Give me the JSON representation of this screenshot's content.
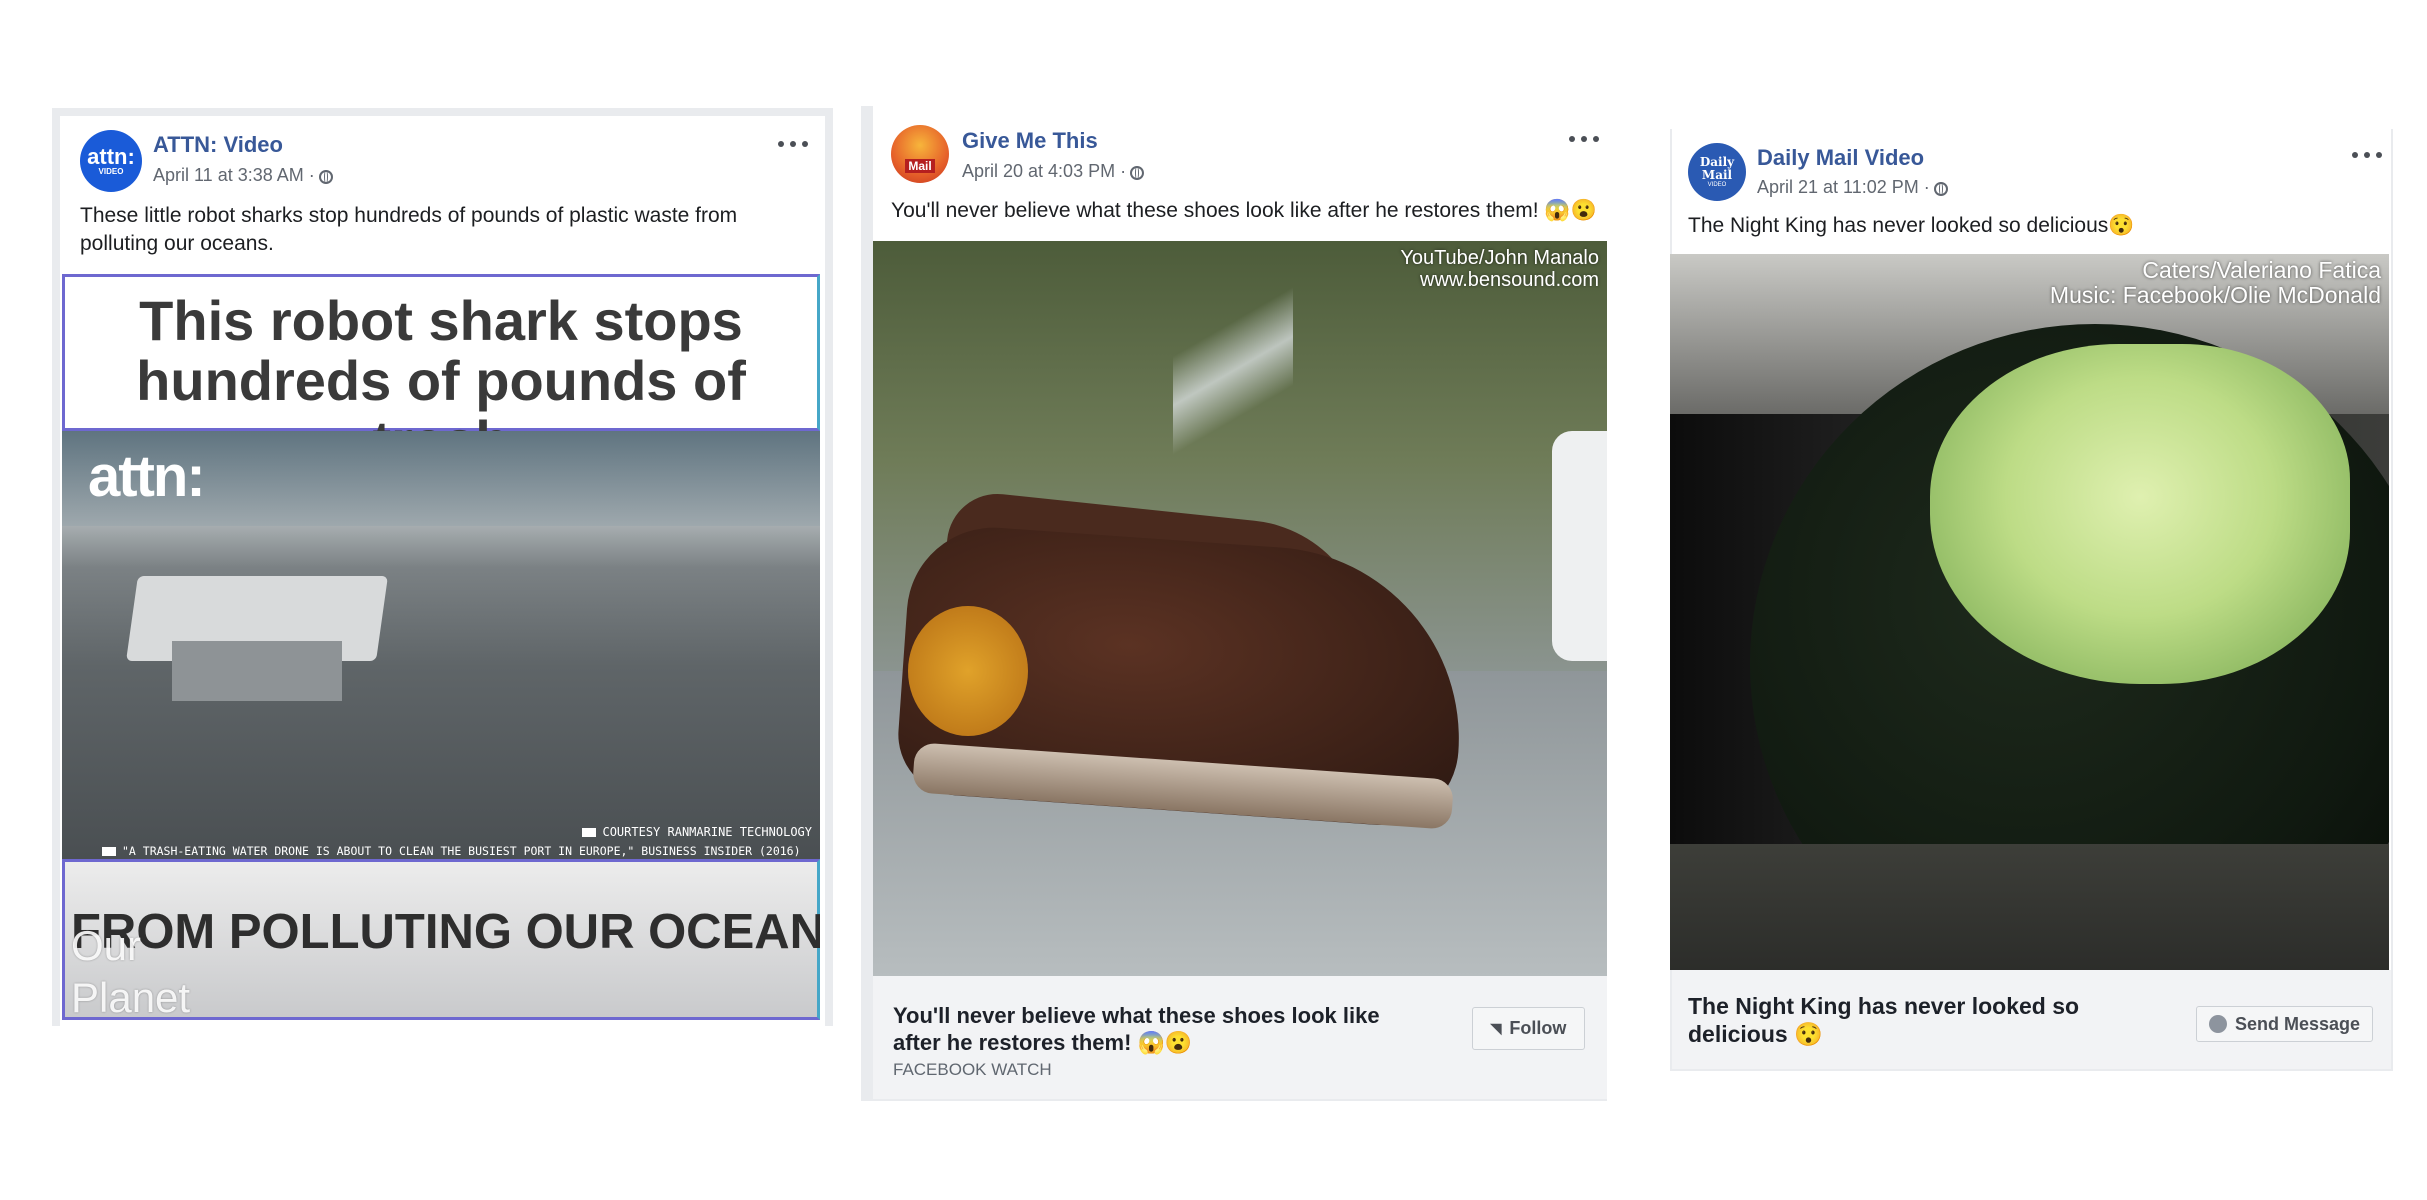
{
  "posts": [
    {
      "page_name": "ATTN: Video",
      "avatar_text": "attn:",
      "avatar_sub": "VIDEO",
      "timestamp": "April 11 at 3:38 AM ·",
      "text": "These little robot sharks stop hundreds of pounds of plastic waste from polluting our oceans.",
      "video": {
        "headline": "This robot shark stops hundreds of pounds of trash",
        "logo": "attn:",
        "credit": "COURTESY RANMARINE TECHNOLOGY",
        "quote": "\"A TRASH-EATING WATER DRONE IS ABOUT TO CLEAN THE BUSIEST PORT IN EUROPE,\" BUSINESS INSIDER (2016)",
        "bottom_text": "FROM POLLUTING OUR OCEANS",
        "watermark": "Our Planet"
      }
    },
    {
      "page_name": "Give Me This",
      "avatar_text": "Mail",
      "timestamp": "April 20 at 4:03 PM ·",
      "text": "You'll never believe what these shoes look like after he restores them! 😱😮",
      "video": {
        "credit_line1": "YouTube/John Manalo",
        "credit_line2": "www.bensound.com"
      },
      "footer": {
        "title": "You'll never believe what these shoes look like after he restores them! 😱😮",
        "source": "FACEBOOK WATCH",
        "button": "Follow"
      }
    },
    {
      "page_name": "Daily Mail Video",
      "avatar_text": "Daily Mail",
      "avatar_sub": "VIDEO",
      "timestamp": "April 21 at 11:02 PM ·",
      "text": "The Night King has never looked so delicious😯",
      "video": {
        "credit_line1": "Caters/Valeriano Fatica",
        "credit_line2": "Music: Facebook/Olie McDonald"
      },
      "footer": {
        "title": "The Night King has never looked so delicious 😯",
        "button": "Send Message"
      }
    }
  ],
  "colors": {
    "link_blue": "#385898",
    "meta_gray": "#616770",
    "footer_bg": "#f2f3f5"
  }
}
